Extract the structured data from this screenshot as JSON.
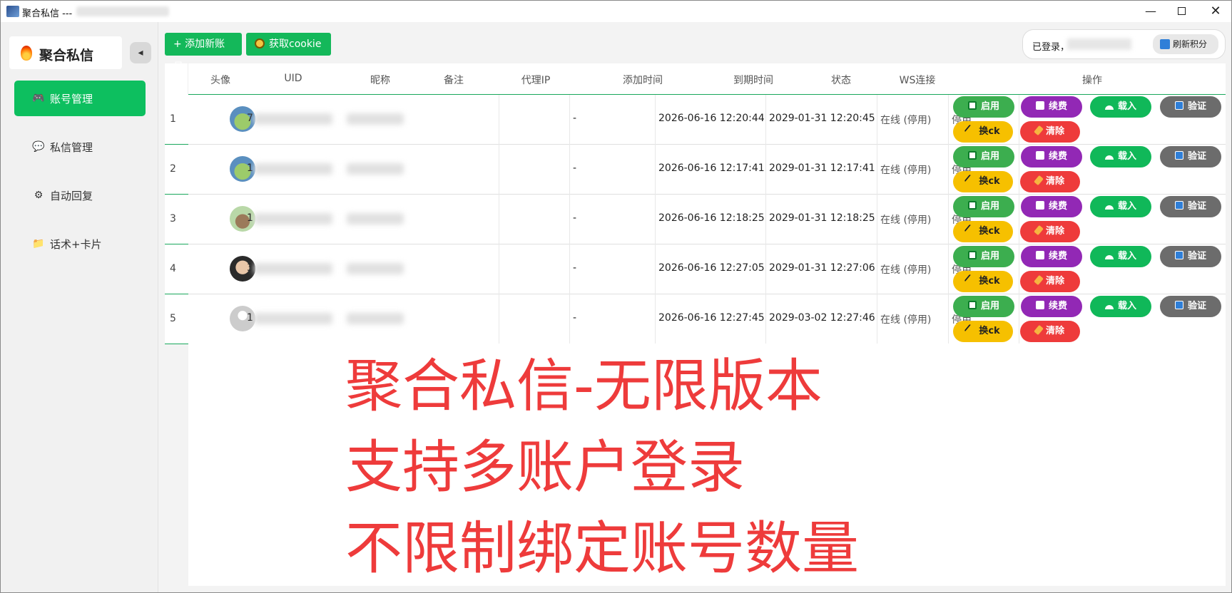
{
  "window": {
    "title": "聚合私信 ---",
    "controls": {
      "minimize": "—",
      "maximize": "",
      "close": "✕"
    }
  },
  "sidebar": {
    "brand": "聚合私信",
    "collapse_icon": "◂",
    "items": [
      {
        "label": "账号管理",
        "icon": "🎮",
        "active": true
      },
      {
        "label": "私信管理",
        "icon": "💬",
        "active": false
      },
      {
        "label": "自动回复",
        "icon": "⚙",
        "active": false
      },
      {
        "label": "话术+卡片",
        "icon": "📁",
        "active": false
      }
    ]
  },
  "toolbar": {
    "add_account": "+ 添加新账号",
    "get_cookie": "获取cookie"
  },
  "user": {
    "logged_in": "已登录，",
    "refresh": "刷新积分"
  },
  "table": {
    "headers": [
      "头像",
      "UID",
      "昵称",
      "备注",
      "代理IP",
      "添加时间",
      "到期时间",
      "状态",
      "WS连接",
      "操作"
    ],
    "rows": [
      {
        "index": "1",
        "uid_prefix": "7",
        "remark": "",
        "proxy": "-",
        "added": "2026-06-16 12:20:44",
        "expires": "2029-01-31 12:20:45",
        "status": "在线 (停用)",
        "ws": "停用",
        "avatar": "green"
      },
      {
        "index": "2",
        "uid_prefix": "1",
        "remark": "",
        "proxy": "-",
        "added": "2026-06-16 12:17:41",
        "expires": "2029-01-31 12:17:41",
        "status": "在线 (停用)",
        "ws": "停用",
        "avatar": "green"
      },
      {
        "index": "3",
        "uid_prefix": "1",
        "remark": "",
        "proxy": "-",
        "added": "2026-06-16 12:18:25",
        "expires": "2029-01-31 12:18:25",
        "status": "在线 (停用)",
        "ws": "停用",
        "avatar": "mint"
      },
      {
        "index": "4",
        "uid_prefix": "3",
        "remark": "",
        "proxy": "-",
        "added": "2026-06-16 12:27:05",
        "expires": "2029-01-31 12:27:06",
        "status": "在线 (停用)",
        "ws": "停用",
        "avatar": "dark"
      },
      {
        "index": "5",
        "uid_prefix": "1",
        "remark": "",
        "proxy": "-",
        "added": "2026-06-16 12:27:45",
        "expires": "2029-03-02 12:27:46",
        "status": "在线 (停用)",
        "ws": "停用",
        "avatar": "grey"
      }
    ],
    "actions": {
      "enable": "启用",
      "renew": "续费",
      "load": "载入",
      "verify": "验证",
      "swap_ck": "换ck",
      "clear": "清除"
    }
  },
  "overlay": {
    "line1": "聚合私信-无限版本",
    "line2": "支持多账户登录",
    "line3": "不限制绑定账号数量"
  },
  "colors": {
    "primary_green": "#0dbf5f",
    "enable": "#3cae4f",
    "renew": "#9228b5",
    "load": "#10b859",
    "verify": "#6c6c6c",
    "swap": "#f6c000",
    "clear": "#ee3b3b",
    "overlay_text": "#ee3b3b"
  }
}
